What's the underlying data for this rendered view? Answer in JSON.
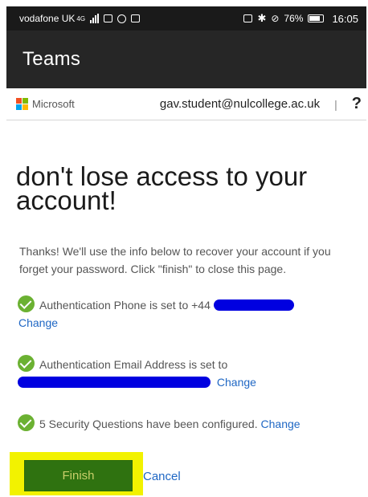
{
  "status_bar": {
    "carrier": "vodafone UK",
    "network": "4G",
    "battery": "76%",
    "time": "16:05"
  },
  "app_bar": {
    "title": "Teams"
  },
  "ms_header": {
    "brand": "Microsoft",
    "account": "gav.student@nulcollege.ac.uk",
    "separator": "|",
    "help": "?"
  },
  "content": {
    "heading": "don't lose access to your account!",
    "intro": "Thanks! We'll use the info below to recover your account if you forget your password. Click \"finish\" to close this page.",
    "items": [
      {
        "text": "Authentication Phone is set to +44",
        "link": "Change"
      },
      {
        "text": "Authentication Email Address is set to",
        "link": "Change"
      },
      {
        "text": "5 Security Questions have been configured.",
        "link": "Change"
      }
    ]
  },
  "actions": {
    "finish": "Finish",
    "cancel": "Cancel"
  },
  "colors": {
    "check_green": "#6bb132",
    "link_blue": "#1f67c4",
    "finish_green": "#2f7210",
    "highlight_yellow": "#f2f200",
    "redaction_blue": "#0000e0"
  }
}
